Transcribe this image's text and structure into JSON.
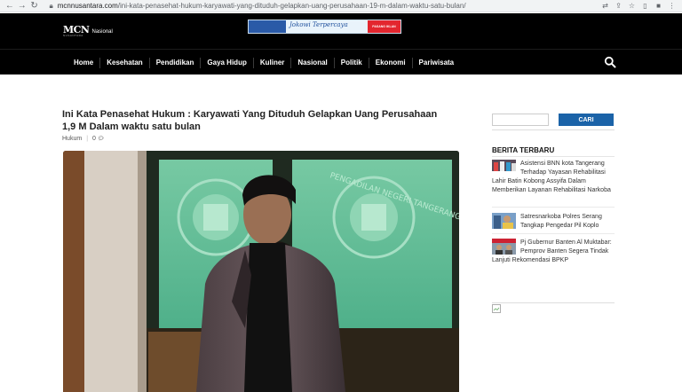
{
  "browser": {
    "url_domain": "mcnnusantara.com",
    "url_path": "/ini-kata-penasehat-hukum-karyawati-yang-dituduh-gelapkan-uang-perusahaan-19-m-dalam-waktu-satu-bulan/"
  },
  "header": {
    "logo_mark": "MCN",
    "logo_text": "Nasional",
    "logo_sub": "NUSANTARA",
    "banner_text": "Jokowi Terpercaya",
    "banner_button": "PASANG IKLAN",
    "menu": [
      "Home",
      "Kesehatan",
      "Pendidikan",
      "Gaya Hidup",
      "Kuliner",
      "Nasional",
      "Politik",
      "Ekonomi",
      "Pariwisata"
    ]
  },
  "article": {
    "title": "Ini Kata Penasehat Hukum : Karyawati Yang Dituduh Gelapkan Uang Perusahaan 1,9 M Dalam waktu satu bulan",
    "category": "Hukum",
    "separator": "|",
    "comment_count": "0",
    "photo_sign": "PENGADILAN NEGERI TANGERANG"
  },
  "sidebar": {
    "search_placeholder": "",
    "search_button": "CARI",
    "heading": "BERITA TERBARU",
    "news": [
      {
        "text": "Asistensi BNN kota Tangerang Terhadap Yayasan Rehabilitasi Lahir Batin Kobong Assyifa Dalam Memberikan Layanan Rehabilitasi Narkoba"
      },
      {
        "text": "Satresnarkoba Polres Serang Tangkap Pengedar Pil Koplo"
      },
      {
        "text": "Pj Gubernur Banten Al Muktabar: Pemprov Banten Segera Tindak Lanjuti Rekomendasi BPKP"
      }
    ]
  },
  "colors": {
    "header_bg": "#000000",
    "search_button": "#1b63a8"
  }
}
